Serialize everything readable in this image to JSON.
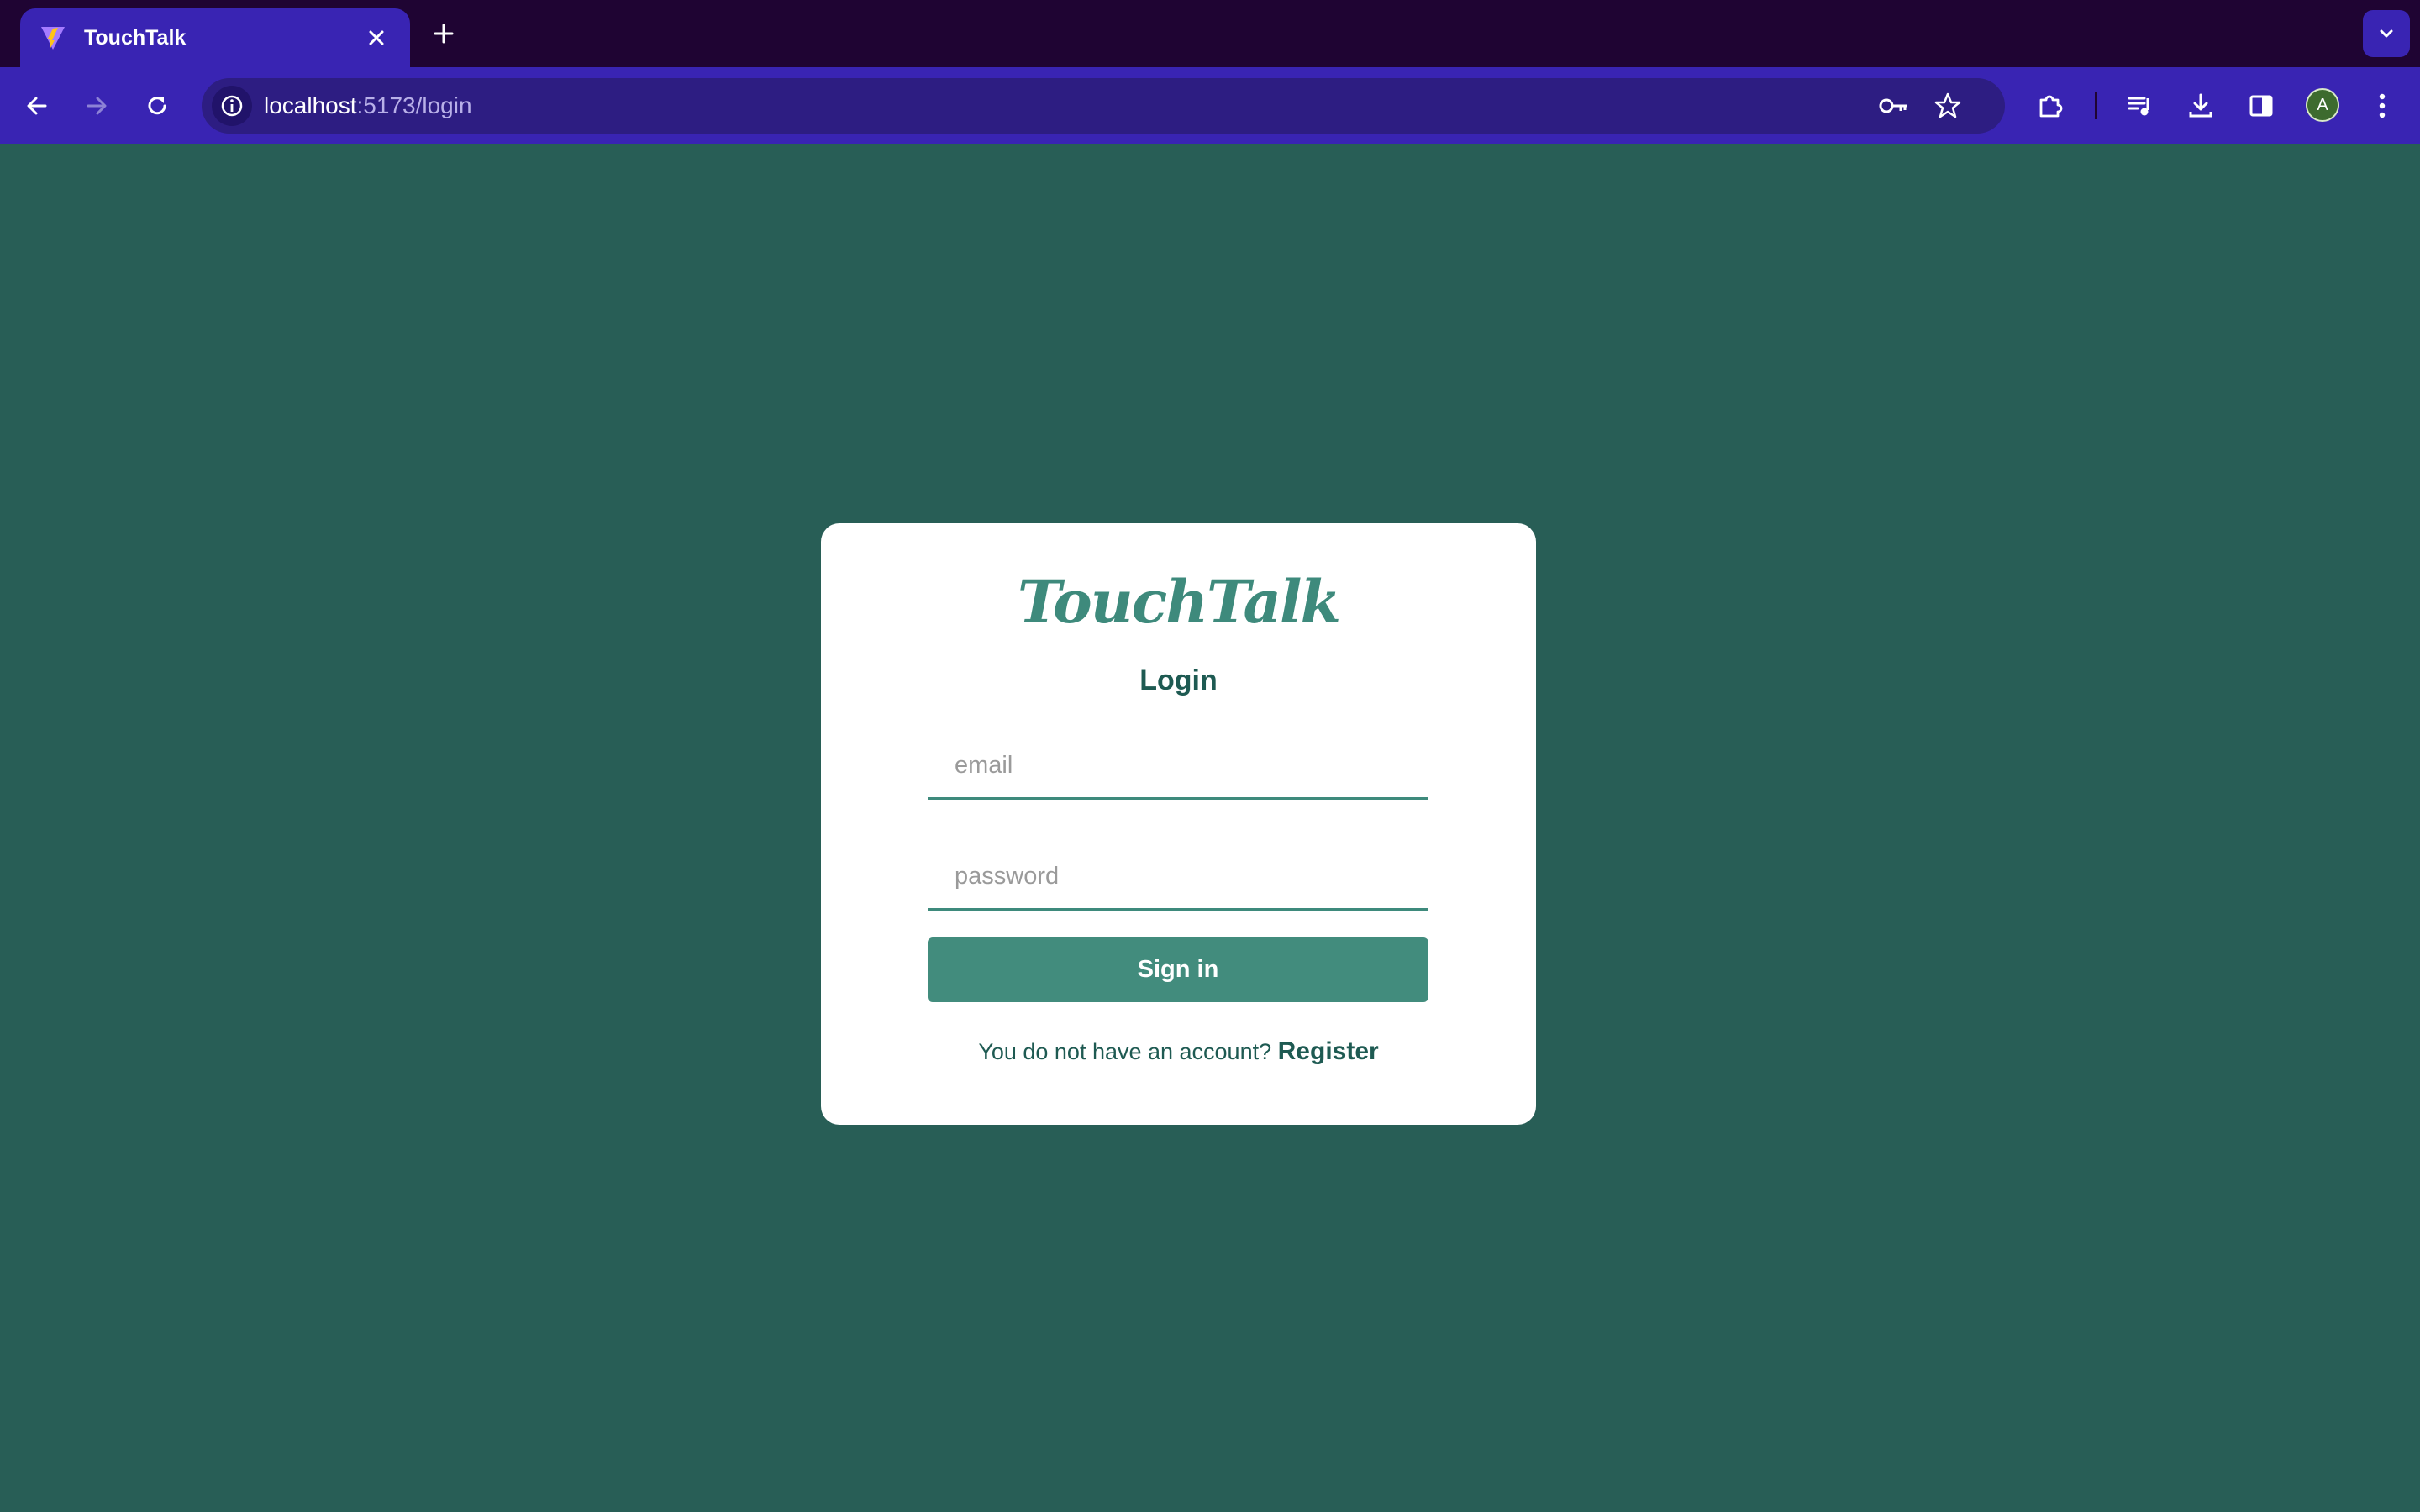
{
  "browser": {
    "tab": {
      "title": "TouchTalk"
    },
    "address": {
      "host": "localhost",
      "path": ":5173/login"
    },
    "profile_initial": "A",
    "colors": {
      "frame": "#1f0433",
      "toolbar": "#3924b3",
      "omnibox": "#2d1d82"
    }
  },
  "page": {
    "background": "#285e56",
    "logo": "TouchTalk",
    "heading": "Login",
    "email_placeholder": "email",
    "password_placeholder": "password",
    "signin_label": "Sign in",
    "register_prompt": "You do not have an account?",
    "register_link": "Register",
    "colors": {
      "accent": "#428c7d",
      "text": "#1e5a52"
    }
  },
  "icons": {
    "favicon": "vite-favicon-icon",
    "tab_close": "close-icon",
    "new_tab": "plus-icon",
    "tab_search": "chevron-down-icon",
    "back": "back-arrow-icon",
    "forward": "forward-arrow-icon",
    "reload": "reload-icon",
    "site_info": "info-icon",
    "password": "key-icon",
    "bookmark": "star-icon",
    "extensions": "puzzle-icon",
    "media": "media-queue-icon",
    "downloads": "download-icon",
    "side_panel": "side-panel-icon",
    "menu": "kebab-menu-icon"
  }
}
